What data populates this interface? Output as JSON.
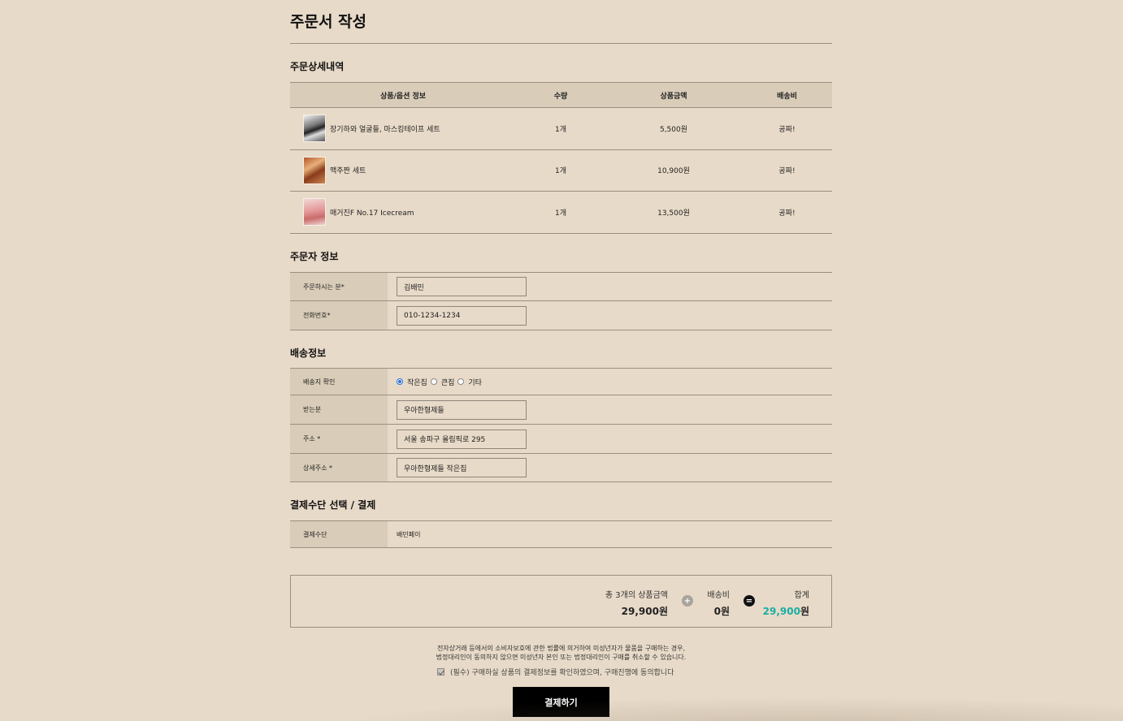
{
  "page_title": "주문서 작성",
  "order_details": {
    "title": "주문상세내역",
    "headers": [
      "상품/옵션 정보",
      "수량",
      "상품금액",
      "배송비"
    ],
    "rows": [
      {
        "name": "장기하와 얼굴들, 마스킹테이프 세트",
        "qty": "1개",
        "price": "5,500원",
        "shipping": "공짜!"
      },
      {
        "name": "맥주짠 세트",
        "qty": "1개",
        "price": "10,900원",
        "shipping": "공짜!"
      },
      {
        "name": "매거진F No.17 Icecream",
        "qty": "1개",
        "price": "13,500원",
        "shipping": "공짜!"
      }
    ]
  },
  "orderer": {
    "title": "주문자 정보",
    "name_label": "주문하시는 분*",
    "name_value": "김배민",
    "phone_label": "전화번호*",
    "phone_value": "010-1234-1234"
  },
  "shipping": {
    "title": "배송정보",
    "dest_label": "배송지 확인",
    "options": [
      "작은집",
      "큰집",
      "기타"
    ],
    "selected": "작은집",
    "recipient_label": "받는분",
    "recipient_value": "우아한형제들",
    "address_label": "주소 *",
    "address_value": "서울 송파구 올림픽로 295",
    "detail_label": "상세주소 *",
    "detail_value": "우아한형제들 작은집"
  },
  "payment": {
    "title": "결제수단 선택 / 결제",
    "method_label": "결제수단",
    "method_value": "배민페이"
  },
  "summary": {
    "items_label": "총 3개의 상품금액",
    "items_value": "29,900원",
    "plus_symbol": "+",
    "shipping_label": "배송비",
    "shipping_value": "0원",
    "equals_symbol": "=",
    "total_label": "합계",
    "total_number": "29,900",
    "total_unit": "원",
    "accent_color": "#1aaea3"
  },
  "notice": {
    "line1": "전자상거래 등에서의 소비자보호에 관한 법률에 의거하여 미성년자가 물품을 구매하는 경우,",
    "line2": "법정대리인이 동의하지 않으면 미성년자 본인 또는 법정대리인이 구매를 취소할 수 있습니다.",
    "agree": "(필수) 구매하실 상품의 결제정보를 확인하였으며, 구매진행에 동의합니다"
  },
  "pay_button": "결제하기"
}
